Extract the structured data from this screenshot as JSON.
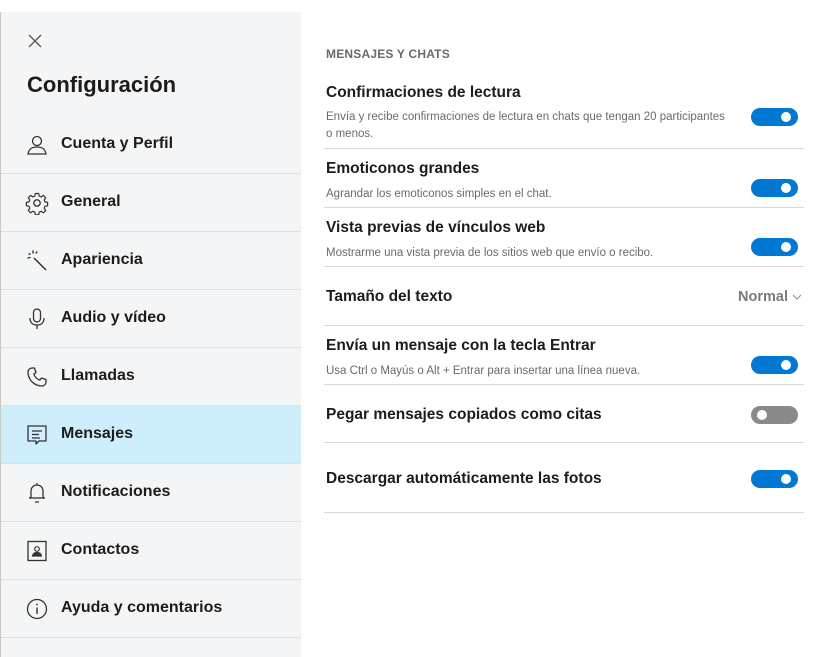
{
  "sidebar": {
    "close_icon": "close-icon",
    "title": "Configuración",
    "items": [
      {
        "label": "Cuenta y Perfil",
        "icon": "person-icon"
      },
      {
        "label": "General",
        "icon": "gear-icon"
      },
      {
        "label": "Apariencia",
        "icon": "magic-wand-icon"
      },
      {
        "label": "Audio y vídeo",
        "icon": "microphone-icon"
      },
      {
        "label": "Llamadas",
        "icon": "phone-icon"
      },
      {
        "label": "Mensajes",
        "icon": "message-icon"
      },
      {
        "label": "Notificaciones",
        "icon": "bell-icon"
      },
      {
        "label": "Contactos",
        "icon": "contact-card-icon"
      },
      {
        "label": "Ayuda y comentarios",
        "icon": "info-icon"
      }
    ],
    "active_item": "Mensajes"
  },
  "main": {
    "section_title": "MENSAJES Y CHATS",
    "settings": [
      {
        "title": "Confirmaciones de lectura",
        "description": "Envía y recibe confirmaciones de lectura en chats que tengan 20 participantes o menos.",
        "control": "toggle",
        "state": "on"
      },
      {
        "title": "Emoticonos grandes",
        "description": "Agrandar los emoticonos simples en el chat.",
        "control": "toggle",
        "state": "on"
      },
      {
        "title": "Vista previas de vínculos web",
        "description": "Mostrarme una vista previa de los sitios web que envío o recibo.",
        "control": "toggle",
        "state": "on"
      },
      {
        "title": "Tamaño del texto",
        "control": "dropdown",
        "value": "Normal"
      },
      {
        "title": "Envía un mensaje con la tecla Entrar",
        "description": "Usa Ctrl o Mayús o Alt + Entrar para insertar una línea nueva.",
        "control": "toggle",
        "state": "on"
      },
      {
        "title": "Pegar mensajes copiados como citas",
        "control": "toggle",
        "state": "off"
      },
      {
        "title": "Descargar automáticamente las fotos",
        "control": "toggle",
        "state": "on"
      }
    ]
  },
  "colors": {
    "accent": "#0078d4",
    "active_nav_bg": "#cfeefb",
    "sidebar_bg": "#f3f5f6",
    "toggle_off": "#8a8a8a"
  }
}
